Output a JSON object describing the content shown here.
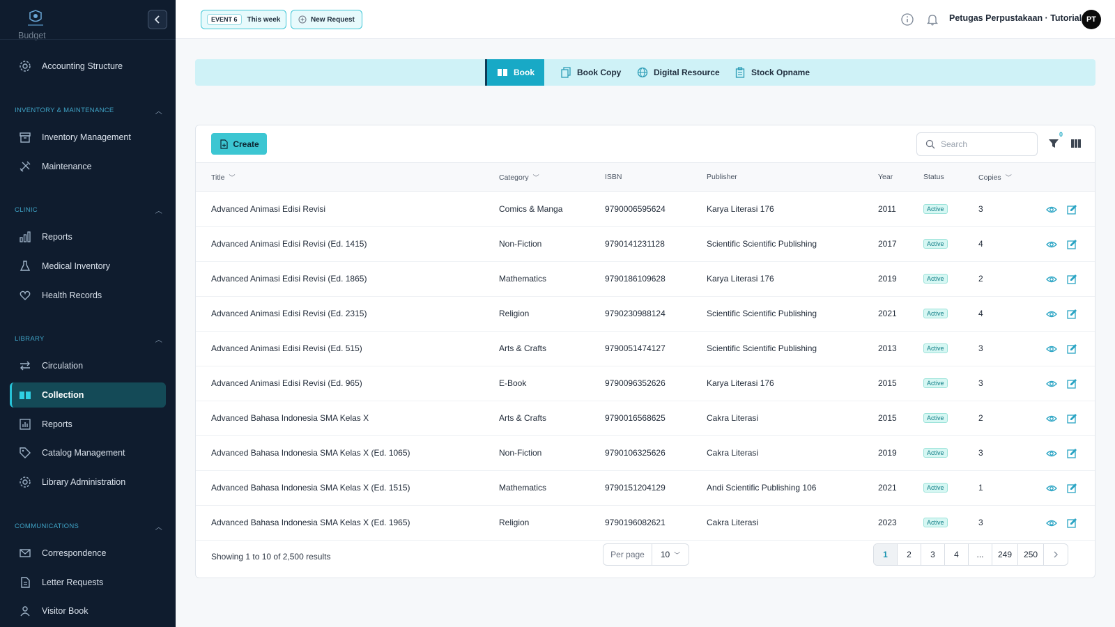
{
  "sidebar": {
    "logo_icon": "school-crest-logo",
    "partial_item": "Budget",
    "accounting": "Accounting Structure",
    "sections": {
      "inventory": "INVENTORY & MAINTENANCE",
      "clinic": "CLINIC",
      "library": "LIBRARY",
      "communications": "COMMUNICATIONS"
    },
    "items": {
      "inventory_management": "Inventory Management",
      "maintenance": "Maintenance",
      "clinic_reports": "Reports",
      "medical_inventory": "Medical Inventory",
      "health_records": "Health Records",
      "circulation": "Circulation",
      "collection": "Collection",
      "library_reports": "Reports",
      "catalog_management": "Catalog Management",
      "library_administration": "Library Administration",
      "correspondence": "Correspondence",
      "letter_requests": "Letter Requests",
      "visitor_book": "Visitor Book"
    }
  },
  "topbar": {
    "event_tag": "EVENT 6",
    "event_label": "This week",
    "new_request": "New Request",
    "user_name": "Petugas Perpustakaan · Tutorial",
    "avatar_initials": "PT"
  },
  "tabs": {
    "book": "Book",
    "book_copy": "Book Copy",
    "digital_resource": "Digital Resource",
    "stock_opname": "Stock Opname"
  },
  "toolbar": {
    "create": "Create",
    "search_placeholder": "Search",
    "filter_count": "0"
  },
  "table": {
    "headers": {
      "title": "Title",
      "category": "Category",
      "isbn": "ISBN",
      "publisher": "Publisher",
      "year": "Year",
      "status": "Status",
      "copies": "Copies"
    },
    "rows": [
      {
        "title": "Advanced Animasi Edisi Revisi",
        "category": "Comics & Manga",
        "isbn": "9790006595624",
        "publisher": "Karya Literasi 176",
        "year": "2011",
        "status": "Active",
        "copies": "3"
      },
      {
        "title": "Advanced Animasi Edisi Revisi (Ed. 1415)",
        "category": "Non-Fiction",
        "isbn": "9790141231128",
        "publisher": "Scientific Scientific Publishing",
        "year": "2017",
        "status": "Active",
        "copies": "4"
      },
      {
        "title": "Advanced Animasi Edisi Revisi (Ed. 1865)",
        "category": "Mathematics",
        "isbn": "9790186109628",
        "publisher": "Karya Literasi 176",
        "year": "2019",
        "status": "Active",
        "copies": "2"
      },
      {
        "title": "Advanced Animasi Edisi Revisi (Ed. 2315)",
        "category": "Religion",
        "isbn": "9790230988124",
        "publisher": "Scientific Scientific Publishing",
        "year": "2021",
        "status": "Active",
        "copies": "4"
      },
      {
        "title": "Advanced Animasi Edisi Revisi (Ed. 515)",
        "category": "Arts & Crafts",
        "isbn": "9790051474127",
        "publisher": "Scientific Scientific Publishing",
        "year": "2013",
        "status": "Active",
        "copies": "3"
      },
      {
        "title": "Advanced Animasi Edisi Revisi (Ed. 965)",
        "category": "E-Book",
        "isbn": "9790096352626",
        "publisher": "Karya Literasi 176",
        "year": "2015",
        "status": "Active",
        "copies": "3"
      },
      {
        "title": "Advanced Bahasa Indonesia SMA Kelas X",
        "category": "Arts & Crafts",
        "isbn": "9790016568625",
        "publisher": "Cakra Literasi",
        "year": "2015",
        "status": "Active",
        "copies": "2"
      },
      {
        "title": "Advanced Bahasa Indonesia SMA Kelas X (Ed. 1065)",
        "category": "Non-Fiction",
        "isbn": "9790106325626",
        "publisher": "Cakra Literasi",
        "year": "2019",
        "status": "Active",
        "copies": "3"
      },
      {
        "title": "Advanced Bahasa Indonesia SMA Kelas X (Ed. 1515)",
        "category": "Mathematics",
        "isbn": "9790151204129",
        "publisher": "Andi Scientific Publishing 106",
        "year": "2021",
        "status": "Active",
        "copies": "1"
      },
      {
        "title": "Advanced Bahasa Indonesia SMA Kelas X (Ed. 1965)",
        "category": "Religion",
        "isbn": "9790196082621",
        "publisher": "Cakra Literasi",
        "year": "2023",
        "status": "Active",
        "copies": "3"
      }
    ]
  },
  "footer": {
    "showing": "Showing 1 to 10 of 2,500 results",
    "per_page_label": "Per page",
    "per_page_value": "10",
    "pages": [
      "1",
      "2",
      "3",
      "4",
      "...",
      "249",
      "250"
    ],
    "current_page": "1"
  },
  "colors": {
    "sidebar_bg": "#0f1c2e",
    "accent": "#18a9c6",
    "tabs_bg": "#cff2f7",
    "create_btn": "#3cc6d2",
    "active_badge": "#d6f7f3"
  }
}
